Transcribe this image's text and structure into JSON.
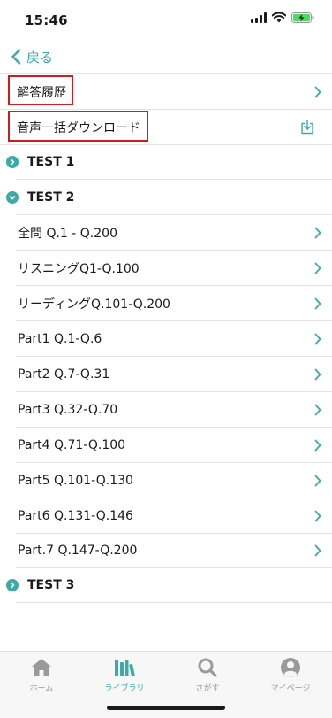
{
  "status_bar": {
    "time": "15:46"
  },
  "nav": {
    "back_label": "戻る"
  },
  "top_items": [
    {
      "label": "解答履歴"
    },
    {
      "label": "音声一括ダウンロード"
    }
  ],
  "sections": [
    {
      "label": "TEST 1",
      "expanded": false
    },
    {
      "label": "TEST 2",
      "expanded": true
    },
    {
      "label": "TEST 3",
      "expanded": false
    }
  ],
  "test2_items": [
    {
      "label": "全問 Q.1 - Q.200"
    },
    {
      "label": "リスニングQ1-Q.100"
    },
    {
      "label": "リーディングQ.101-Q.200"
    },
    {
      "label": "Part1 Q.1-Q.6"
    },
    {
      "label": "Part2 Q.7-Q.31"
    },
    {
      "label": "Part3 Q.32-Q.70"
    },
    {
      "label": "Part4 Q.71-Q.100"
    },
    {
      "label": "Part5 Q.101-Q.130"
    },
    {
      "label": "Part6 Q.131-Q.146"
    },
    {
      "label": "Part.7 Q.147-Q.200"
    }
  ],
  "tabs": [
    {
      "label": "ホーム",
      "icon": "home-icon",
      "active": false
    },
    {
      "label": "ライブラリ",
      "icon": "library-icon",
      "active": true
    },
    {
      "label": "さがす",
      "icon": "search-icon",
      "active": false
    },
    {
      "label": "マイページ",
      "icon": "profile-icon",
      "active": false
    }
  ],
  "colors": {
    "accent": "#3aaba6",
    "highlight": "#d11a1a",
    "inactive": "#9a9a9a"
  }
}
